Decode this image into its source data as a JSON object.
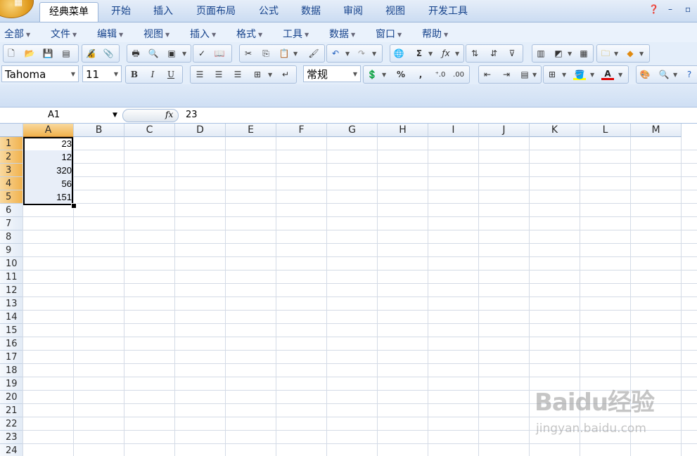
{
  "ribbon_tabs": [
    "经典菜单",
    "开始",
    "插入",
    "页面布局",
    "公式",
    "数据",
    "审阅",
    "视图",
    "开发工具"
  ],
  "menu": [
    "全部",
    "文件",
    "编辑",
    "视图",
    "插入",
    "格式",
    "工具",
    "数据",
    "窗口",
    "帮助"
  ],
  "font": {
    "name": "Tahoma",
    "size": "11"
  },
  "number_format": "常规",
  "name_box": "A1",
  "fx_label": "fx",
  "formula": "23",
  "columns": [
    "A",
    "B",
    "C",
    "D",
    "E",
    "F",
    "G",
    "H",
    "I",
    "J",
    "K",
    "L",
    "M"
  ],
  "rows": [
    "1",
    "2",
    "3",
    "4",
    "5",
    "6",
    "7",
    "8",
    "9",
    "10",
    "11",
    "12",
    "13",
    "14",
    "15",
    "16",
    "17",
    "18",
    "19",
    "20",
    "21",
    "22",
    "23",
    "24"
  ],
  "cells_A": [
    "23",
    "12",
    "320",
    "56",
    "151"
  ],
  "icons": [
    "new",
    "open",
    "save",
    "export",
    "permission",
    "print",
    "preview",
    "cut",
    "copy",
    "paste",
    "format-painter",
    "undo",
    "redo",
    "hyperlink",
    "autosum",
    "function",
    "sort-asc",
    "sort-desc",
    "filter",
    "chart",
    "borders",
    "fill-color",
    "font-color",
    "zoom",
    "help"
  ],
  "watermark": {
    "text": "Baidu经验",
    "url": "jingyan.baidu.com"
  }
}
